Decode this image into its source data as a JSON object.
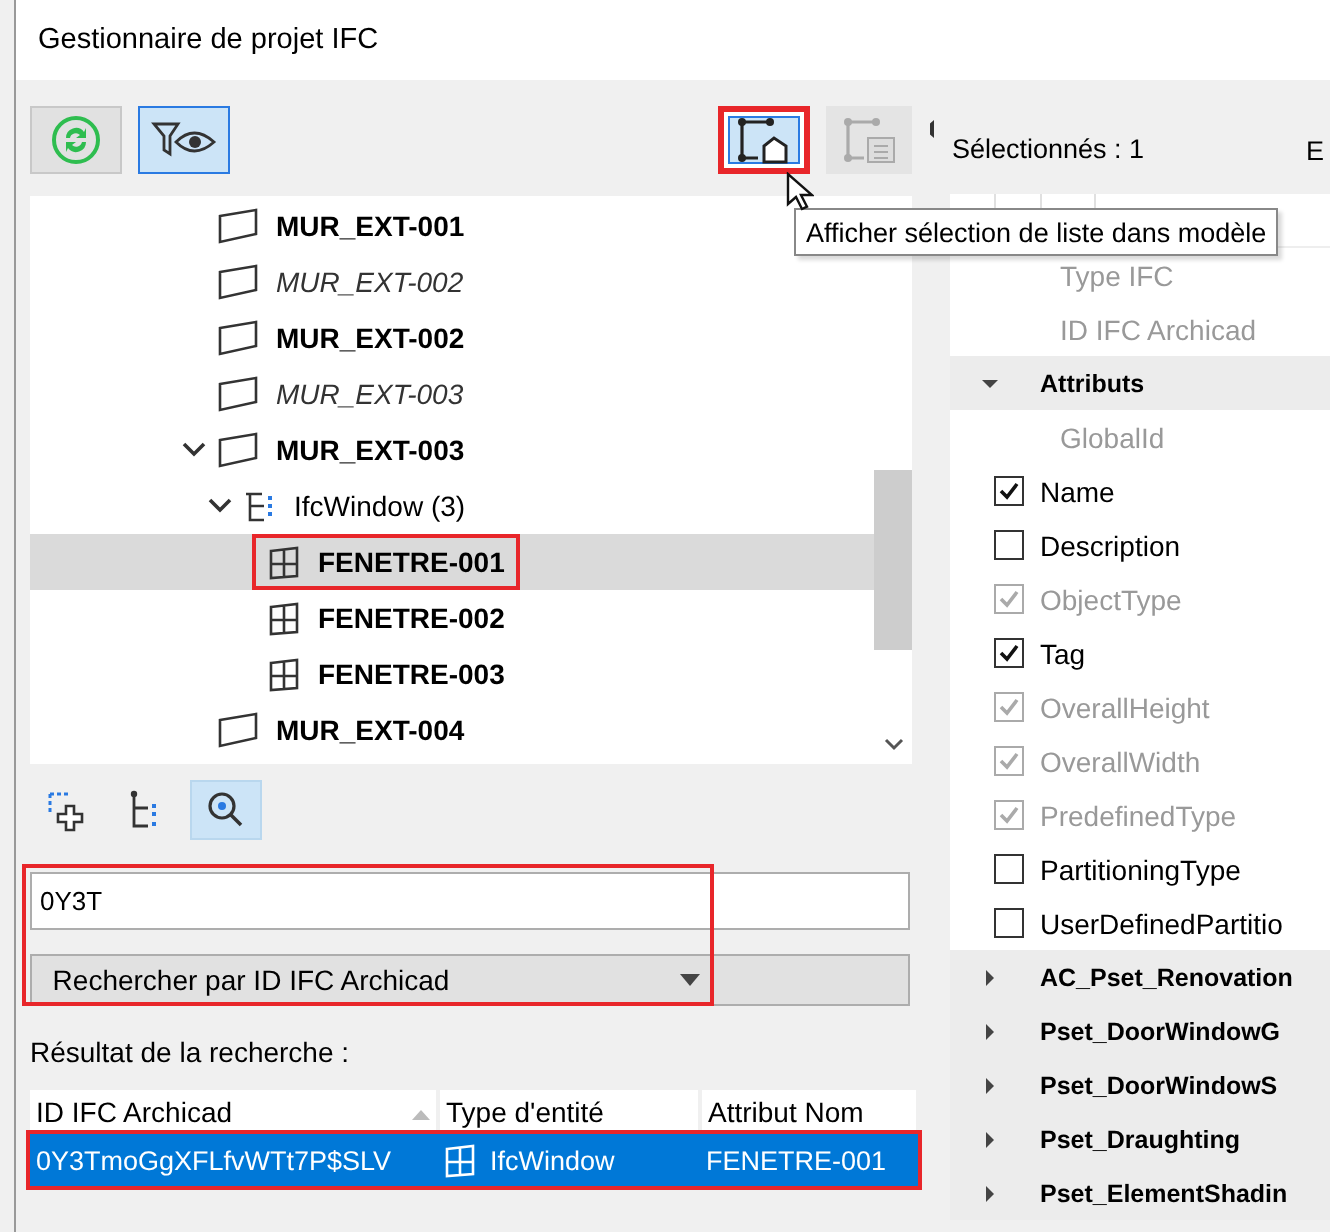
{
  "window": {
    "title": "Gestionnaire de projet IFC"
  },
  "toolbar": {
    "buttons": [
      {
        "kind": "refresh",
        "selected": false,
        "disabled": false
      },
      {
        "kind": "filter-view",
        "selected": true,
        "disabled": false
      },
      {
        "kind": "show-in-model",
        "selected": true,
        "disabled": false,
        "highlighted": true
      },
      {
        "kind": "list-in-model",
        "selected": false,
        "disabled": true
      }
    ]
  },
  "tooltip": {
    "text": "Afficher sélection de liste dans modèle"
  },
  "tree": {
    "items": [
      {
        "label": "MUR_EXT-001",
        "kind": "wall",
        "bold": true,
        "italic": false,
        "selected": false
      },
      {
        "label": "MUR_EXT-002",
        "kind": "wall",
        "bold": false,
        "italic": true,
        "selected": false
      },
      {
        "label": "MUR_EXT-002",
        "kind": "wall",
        "bold": true,
        "italic": false,
        "selected": false
      },
      {
        "label": "MUR_EXT-003",
        "kind": "wall",
        "bold": false,
        "italic": true,
        "selected": false
      },
      {
        "label": "MUR_EXT-003",
        "kind": "wall",
        "bold": true,
        "italic": false,
        "selected": false,
        "expanded": true,
        "children": [
          {
            "label": "IfcWindow (3)",
            "kind": "type-group",
            "bold": false,
            "italic": false,
            "selected": false,
            "expanded": true,
            "children": [
              {
                "label": "FENETRE-001",
                "kind": "window",
                "bold": true,
                "italic": false,
                "selected": true,
                "highlighted": true
              },
              {
                "label": "FENETRE-002",
                "kind": "window",
                "bold": true,
                "italic": false,
                "selected": false
              },
              {
                "label": "FENETRE-003",
                "kind": "window",
                "bold": true,
                "italic": false,
                "selected": false
              }
            ]
          }
        ]
      },
      {
        "label": "MUR_EXT-004",
        "kind": "wall",
        "bold": true,
        "italic": false,
        "selected": false
      }
    ]
  },
  "modes": [
    {
      "kind": "add-selection",
      "selected": false
    },
    {
      "kind": "tree",
      "selected": false
    },
    {
      "kind": "search",
      "selected": true
    }
  ],
  "search": {
    "value": "0Y3T",
    "button": "Rechercher par ID IFC Archicad",
    "highlighted": true
  },
  "results": {
    "label": "Résultat de la recherche :",
    "columns": [
      {
        "label": "ID IFC Archicad",
        "sorted": true
      },
      {
        "label": "Type d'entité",
        "sorted": false
      },
      {
        "label": "Attribut Nom",
        "sorted": false
      }
    ],
    "rows": [
      {
        "cells": [
          {
            "text": "0Y3TmoGgXFLfvWTt7P$SLV",
            "kind": "text"
          },
          {
            "text": "IfcWindow",
            "kind": "window"
          },
          {
            "text": "FENETRE-001",
            "kind": "text"
          }
        ],
        "selected": true,
        "highlighted": true
      }
    ]
  },
  "properties": {
    "selected_label": "Sélectionnés : 1",
    "column_2": "E",
    "items": [
      {
        "kind": "field",
        "label": "Type IFC"
      },
      {
        "kind": "field",
        "label": "ID IFC Archicad"
      },
      {
        "kind": "group",
        "label": "Attributs",
        "expanded": true
      },
      {
        "kind": "field",
        "label": "GlobalId"
      },
      {
        "kind": "check",
        "label": "Name",
        "checked": true,
        "disabled": false
      },
      {
        "kind": "check",
        "label": "Description",
        "checked": false,
        "disabled": false
      },
      {
        "kind": "check",
        "label": "ObjectType",
        "checked": true,
        "disabled": true
      },
      {
        "kind": "check",
        "label": "Tag",
        "checked": true,
        "disabled": false
      },
      {
        "kind": "check",
        "label": "OverallHeight",
        "checked": true,
        "disabled": true
      },
      {
        "kind": "check",
        "label": "OverallWidth",
        "checked": true,
        "disabled": true
      },
      {
        "kind": "check",
        "label": "PredefinedType",
        "checked": true,
        "disabled": true
      },
      {
        "kind": "check",
        "label": "PartitioningType",
        "checked": false,
        "disabled": false
      },
      {
        "kind": "check",
        "label": "UserDefinedPartitio",
        "checked": false,
        "disabled": false
      },
      {
        "kind": "group",
        "label": "AC_Pset_Renovation",
        "expanded": false
      },
      {
        "kind": "group",
        "label": "Pset_DoorWindowG",
        "expanded": false
      },
      {
        "kind": "group",
        "label": "Pset_DoorWindowS",
        "expanded": false
      },
      {
        "kind": "group",
        "label": "Pset_Draughting",
        "expanded": false
      },
      {
        "kind": "group",
        "label": "Pset_ElementShadin",
        "expanded": false
      }
    ]
  }
}
